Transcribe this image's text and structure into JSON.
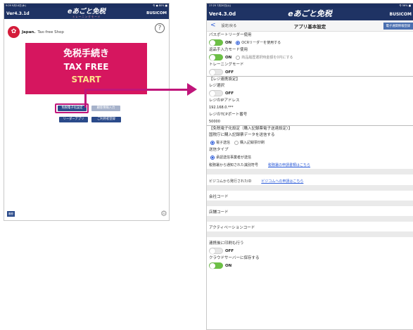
{
  "left": {
    "status_left": "9:09  9月14日(木)",
    "status_right": "令 ● 80% ■",
    "version": "Ver4.3.1d",
    "logo_title": "eあごと免税",
    "logo_sub": "トレーニングモード",
    "busicom": "BUSICOM",
    "brand_jp": "Japan.",
    "brand_sub": "Tax-free Shop",
    "help_glyph": "?",
    "banner": {
      "line1": "免税手続き",
      "line2": "TAX FREE",
      "line3": "START"
    },
    "buttons": {
      "e_tax": "免税電子化設定",
      "customer": "顧客情報入力",
      "reader_app": "リーダーアプリ",
      "registration": "ご利用者登録"
    },
    "history": "履歴",
    "gear_glyph": "⚙"
  },
  "right": {
    "status_left": "17:25  7月20日(火)",
    "status_right": "令 56% ■",
    "version": "Ver4.3.0d",
    "logo_title": "eあごと免税",
    "busicom": "BUSICOM",
    "back_label": "設定/戻る",
    "title": "アプリ基本設定",
    "e_register_button": "電子通関情報登録",
    "passport_reader": {
      "label": "パスポートリーダー使用",
      "toggle": "ON",
      "ocr": "OCRリーダーを使用する"
    },
    "return_mode": {
      "label": "返品手入力モード使用",
      "toggle": "ON",
      "history": "商品履歴選択時金額を0円にする"
    },
    "training_mode": {
      "label": "トレーニングモード",
      "toggle": "OFF"
    },
    "register_section": "【レジ連携設定】",
    "register_select": {
      "label": "レジ選択",
      "toggle": "OFF"
    },
    "ip": {
      "label": "レジのIPアドレス",
      "value": "192.168.0.***"
    },
    "tcp": {
      "label": "レジのTCPポート番号",
      "value": "50000"
    },
    "etax_section": "【免税電子化設定（購入記録票電子送達設定）】",
    "send_label": "国税庁に購入記録票データを送信する",
    "send_options": [
      "電子送信",
      "購入記録票印刷"
    ],
    "send_type": {
      "label": "送信タイプ",
      "option": "承認送信事業者が送信"
    },
    "tax_office_id": {
      "label": "税務署から通知された識別符号",
      "link": "税務署の申請書類はこちら"
    },
    "busicom_id": {
      "label": "ビジコムから発行されたID",
      "link": "ビジコムへの申請はこちら"
    },
    "company_code": "会社コード",
    "store_code": "店舗コード",
    "activation_code": "アクティベーションコード",
    "print_after": {
      "label": "連携後に印刷も行う",
      "toggle": "OFF"
    },
    "cloud_save": {
      "label": "クラウドサーバーに保存する",
      "toggle": "ON"
    }
  }
}
